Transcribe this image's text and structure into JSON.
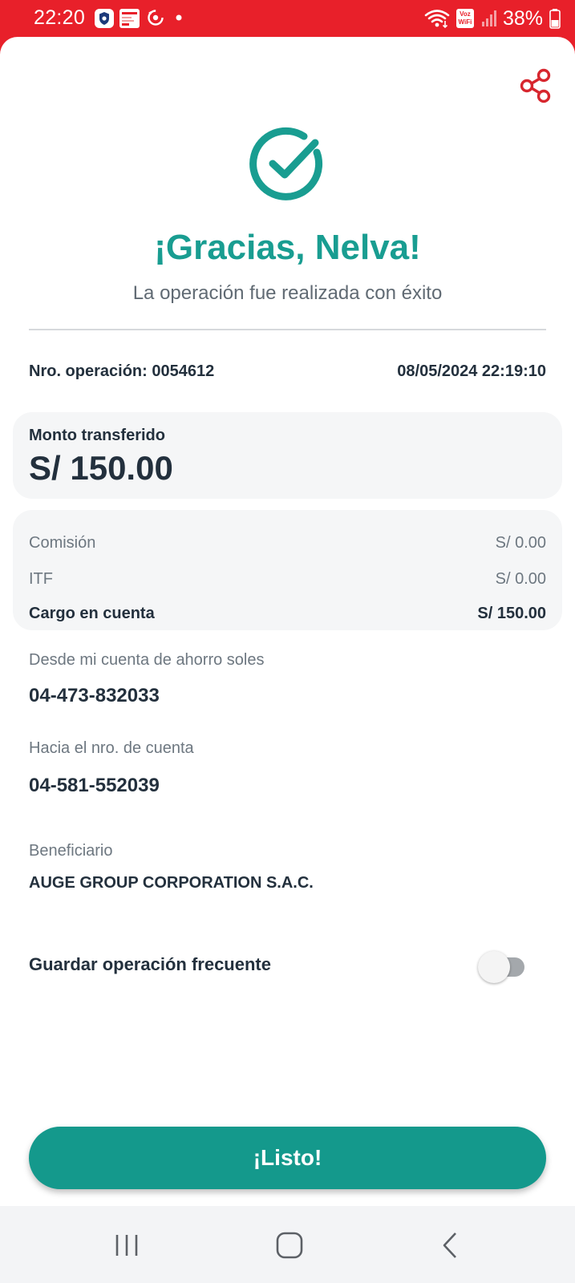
{
  "status_bar": {
    "time": "22:20",
    "battery": "38%",
    "wifi_badge": "Voz WiFi",
    "icons": [
      "security-shield-icon",
      "calendar-app-icon",
      "sync-icon",
      "notification-dot-icon",
      "wifi-icon",
      "signal-icon",
      "battery-icon"
    ]
  },
  "header": {
    "share_icon": "share-icon"
  },
  "success": {
    "icon": "check-circle-icon",
    "title": "¡Gracias, Nelva!",
    "subtitle": "La operación fue realizada con éxito"
  },
  "operation": {
    "number": "Nro. operación: 0054612",
    "datetime": "08/05/2024 22:19:10"
  },
  "amount": {
    "label": "Monto transferido",
    "value": "S/ 150.00"
  },
  "fees": [
    {
      "label": "Comisión",
      "value": "S/ 0.00"
    },
    {
      "label": "ITF",
      "value": "S/ 0.00"
    },
    {
      "label": "Cargo en cuenta",
      "value": "S/ 150.00"
    }
  ],
  "from_account": {
    "label": "Desde mi cuenta de ahorro soles",
    "value": "04-473-832033"
  },
  "to_account": {
    "label": "Hacia el nro. de cuenta",
    "value": "04-581-552039"
  },
  "beneficiary": {
    "label": "Beneficiario",
    "value": "AUGE GROUP CORPORATION S.A.C."
  },
  "frequent": {
    "label": "Guardar operación frecuente",
    "enabled": false
  },
  "done_button": {
    "label": "¡Listo!"
  },
  "colors": {
    "brand_red": "#e8202a",
    "success_teal": "#199d91",
    "button_teal": "#14998c",
    "text_dark": "#23303d"
  },
  "nav": {
    "icons": [
      "recent-apps-icon",
      "home-icon",
      "back-icon"
    ]
  }
}
